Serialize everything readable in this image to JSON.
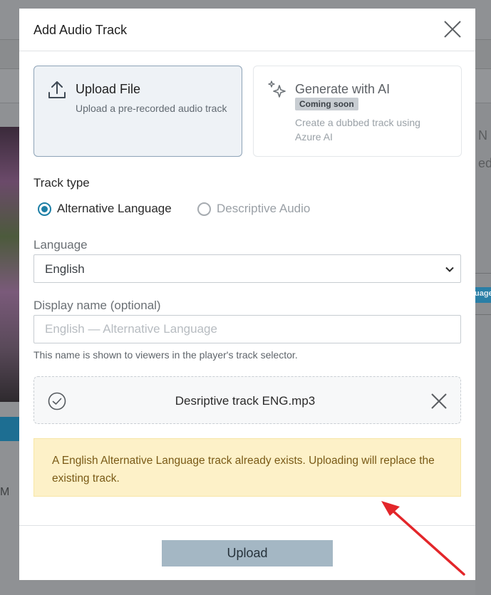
{
  "background": {
    "right_texts": [
      "N",
      "ed"
    ],
    "right_badge": "uage",
    "left_text": "M"
  },
  "modal": {
    "title": "Add Audio Track",
    "options": {
      "upload": {
        "title": "Upload File",
        "description": "Upload a pre-recorded audio track",
        "icon": "upload-icon"
      },
      "ai": {
        "title": "Generate with AI",
        "badge": "Coming soon",
        "description": "Create a dubbed track using Azure AI",
        "icon": "sparkle-icon"
      }
    },
    "track_type": {
      "label": "Track type",
      "options": [
        {
          "label": "Alternative Language",
          "selected": true,
          "enabled": true
        },
        {
          "label": "Descriptive Audio",
          "selected": false,
          "enabled": false
        }
      ]
    },
    "language": {
      "label": "Language",
      "value": "English"
    },
    "display_name": {
      "label": "Display name (optional)",
      "value": "",
      "placeholder": "English — Alternative Language",
      "hint": "This name is shown to viewers in the player's track selector."
    },
    "file": {
      "name": "Desriptive track ENG.mp3"
    },
    "warning": "A English Alternative Language track already exists. Uploading will replace the existing track.",
    "upload_label": "Upload"
  },
  "colors": {
    "accent": "#1d7fa6",
    "warning_bg": "#fdf1c8",
    "warning_text": "#7a5a16",
    "annotation_arrow": "#e3262a",
    "upload_button": "#a4b7c4"
  }
}
